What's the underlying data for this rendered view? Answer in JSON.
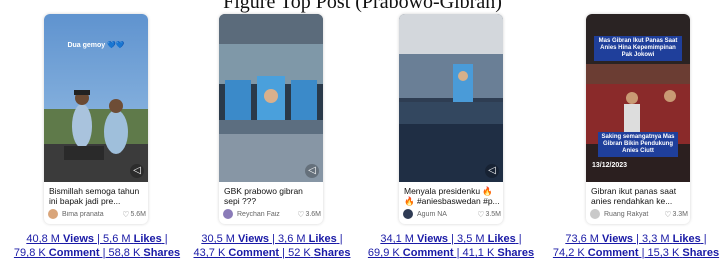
{
  "figure_title": "Figure Top Post (Prabowo-Gibran)",
  "cards": [
    {
      "overlay": "Dua gemoy 💙💙",
      "caption": "Bismillah semoga tahun ini bapak jadi pre...",
      "author": "Bima pranata",
      "likes": "5.6M",
      "stats_line1": {
        "views": "40,8 M",
        "views_label": "Views",
        "likes": "5,6 M",
        "likes_label": "Likes"
      },
      "stats_line2": {
        "comments": "79,8 K",
        "comments_label": "Comment",
        "shares": "58,8 K",
        "shares_label": "Shares"
      }
    },
    {
      "overlay": "",
      "caption": "GBK prabowo gibran sepi ???",
      "author": "Reychan Faiz",
      "likes": "3.6M",
      "stats_line1": {
        "views": "30,5 M",
        "views_label": "Views",
        "likes": "3,6 M",
        "likes_label": "Likes"
      },
      "stats_line2": {
        "comments": "43,7 K",
        "comments_label": "Comment",
        "shares": "52 K",
        "shares_label": "Shares"
      }
    },
    {
      "overlay": "",
      "caption": "Menyala presidenku 🔥 🔥 #aniesbaswedan #p...",
      "author": "Agum NA",
      "likes": "3.5M",
      "stats_line1": {
        "views": "34,1 M",
        "views_label": "Views",
        "likes": "3,5 M",
        "likes_label": "Likes"
      },
      "stats_line2": {
        "comments": "69,9 K",
        "comments_label": "Comment",
        "shares": "41,1 K",
        "shares_label": "Shares"
      }
    },
    {
      "overlay": "Mas Gibran Ikut Panas Saat Anies Hina Kepemimpinan Pak Jokowi",
      "overlay2": "Saking semangatnya Mas Gibran Bikin Pendukung Anies Ciutt",
      "overlay_date": "13/12/2023",
      "caption": "Gibran ikut panas saat anies rendahkan ke...",
      "author": "Ruang Rakyat",
      "likes": "3.3M",
      "stats_line1": {
        "views": "73,6 M",
        "views_label": "Views",
        "likes": "3,3 M",
        "likes_label": "Likes"
      },
      "stats_line2": {
        "comments": "74,2 K",
        "comments_label": "Comment",
        "shares": "15,3 K",
        "shares_label": "Shares"
      }
    }
  ],
  "colors": {
    "link": "#1a1aa6",
    "caption": "#111111",
    "meta": "#666666"
  },
  "icons": {
    "likes": "heart-outline-icon",
    "mute": "speaker-mute-icon"
  }
}
